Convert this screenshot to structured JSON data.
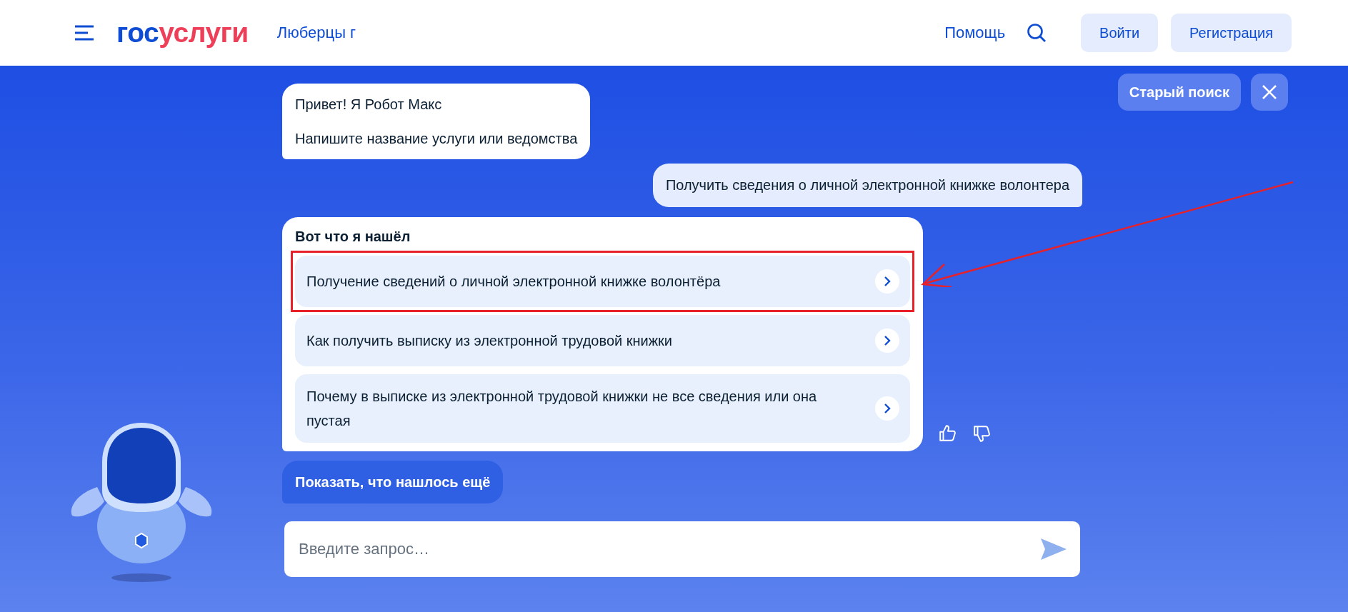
{
  "header": {
    "logo": [
      "гос",
      "услуги"
    ],
    "location": "Люберцы г",
    "help": "Помощь",
    "buttons": [
      "Войти",
      "Регистрация"
    ]
  },
  "top_actions": {
    "old_search": "Старый поиск"
  },
  "messages": [
    {
      "kind": "bot",
      "lines": [
        "Привет! Я Робот Макс",
        "Напишите название услуги или ведомства"
      ]
    },
    {
      "kind": "user",
      "text": "Получить сведения о личной электронной книжке волонтера"
    },
    {
      "kind": "results",
      "title": "Вот что я нашёл",
      "items": [
        {
          "text": "Получение сведений о личной электронной книжке волонтёра",
          "highlighted": true
        },
        {
          "text": "Как получить выписку из электронной трудовой книжки",
          "highlighted": false
        },
        {
          "text": "Почему в выписке из электронной трудовой книжки не все сведения или она пустая",
          "highlighted": false
        }
      ]
    }
  ],
  "show_more": "Показать, что нашлось ещё",
  "input": {
    "placeholder": "Введите запрос…"
  }
}
